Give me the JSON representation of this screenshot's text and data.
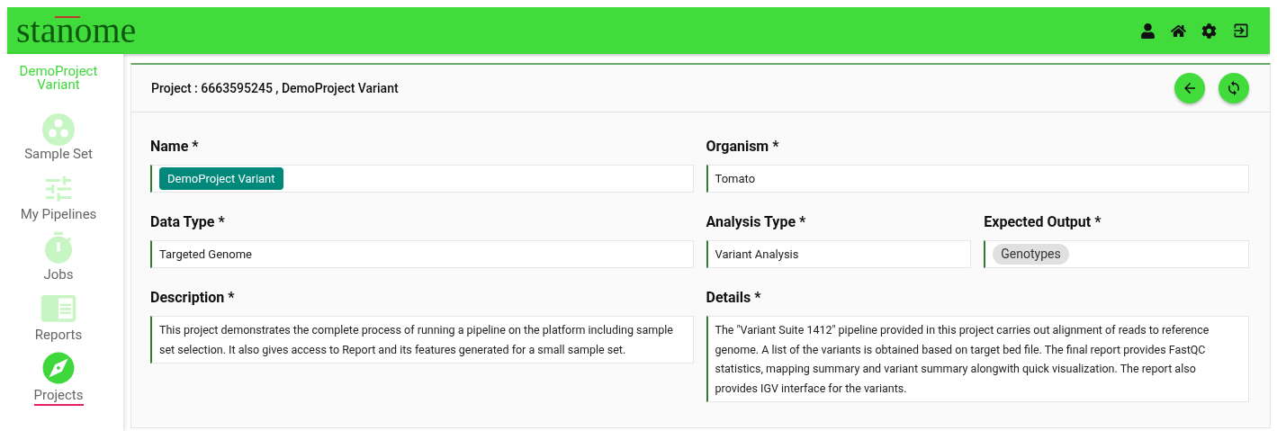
{
  "header": {
    "logo": "stanome",
    "actions": [
      {
        "kind": "user"
      },
      {
        "kind": "home"
      },
      {
        "kind": "settings"
      },
      {
        "kind": "logout"
      }
    ]
  },
  "sidebar": {
    "project_name": "DemoProject Variant",
    "items": [
      {
        "label": "Sample Set",
        "kind": "samples",
        "selected": false
      },
      {
        "label": "My Pipelines",
        "kind": "pipelines",
        "selected": false
      },
      {
        "label": "Jobs",
        "kind": "jobs",
        "selected": false
      },
      {
        "label": "Reports",
        "kind": "reports",
        "selected": false
      },
      {
        "label": "Projects",
        "kind": "projects",
        "selected": true
      }
    ]
  },
  "card": {
    "title": "Project : 6663595245 , DemoProject Variant",
    "buttons": [
      {
        "kind": "back"
      },
      {
        "kind": "refresh"
      }
    ],
    "rows": [
      [
        {
          "label": "Name *",
          "kind": "chip",
          "value": "DemoProject Variant"
        },
        {
          "label": "Organism *",
          "kind": "text",
          "value": "Tomato"
        }
      ],
      [
        {
          "label": "Data Type *",
          "kind": "text",
          "value": "Targeted Genome"
        },
        {
          "label": "Analysis Type *",
          "kind": "text",
          "value": "Variant Analysis"
        },
        {
          "label": "Expected Output *",
          "kind": "tag",
          "value": "Genotypes"
        }
      ],
      [
        {
          "label": "Description *",
          "kind": "multiline",
          "value": "This project demonstrates the complete process of running a pipeline on the platform including sample set selection. It also gives access to Report and its features generated for a small sample set."
        },
        {
          "label": "Details *",
          "kind": "multiline",
          "value": "The \"Variant Suite 1412\" pipeline provided in this project carries out alignment of reads to reference genome. A list of the variants is obtained based on target bed file. The final report provides FastQC statistics, mapping summary and variant summary alongwith quick visualization. The report also provides IGV interface for the variants."
        }
      ]
    ]
  }
}
